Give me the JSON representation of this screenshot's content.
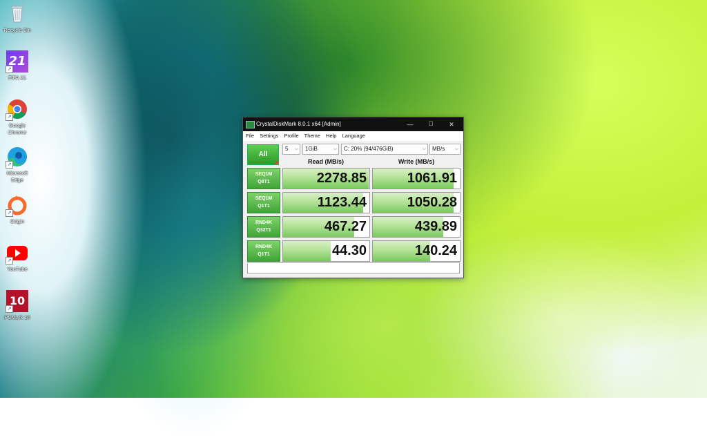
{
  "desktop": {
    "icons": [
      {
        "name": "recycle-bin",
        "label": "Recycle Bin"
      },
      {
        "name": "fifa21",
        "label": "FIFA 21",
        "glyph": "21"
      },
      {
        "name": "google-chrome",
        "label": "Google Chrome"
      },
      {
        "name": "microsoft-edge",
        "label": "Microsoft Edge"
      },
      {
        "name": "origin",
        "label": "Origin"
      },
      {
        "name": "youtube",
        "label": "YouTube"
      },
      {
        "name": "pcmark10",
        "label": "PCMark 10",
        "glyph": "10"
      }
    ]
  },
  "window": {
    "title": "CrystalDiskMark 8.0.1 x64 [Admin]",
    "controls": {
      "minimize": "—",
      "maximize": "☐",
      "close": "✕"
    },
    "menu": [
      "File",
      "Settings",
      "Profile",
      "Theme",
      "Help",
      "Language"
    ],
    "all_button": "All",
    "count": "5",
    "size": "1GiB",
    "drive": "C: 20% (94/476GiB)",
    "unit": "MB/s",
    "headers": {
      "read": "Read (MB/s)",
      "write": "Write (MB/s)"
    },
    "rows": [
      {
        "l1": "SEQ1M",
        "l2": "Q8T1",
        "read": "2278.85",
        "write": "1061.91",
        "read_level": 0.99,
        "write_level": 0.93
      },
      {
        "l1": "SEQ1M",
        "l2": "Q1T1",
        "read": "1123.44",
        "write": "1050.28",
        "read_level": 0.93,
        "write_level": 0.93
      },
      {
        "l1": "RND4K",
        "l2": "Q32T1",
        "read": "467.27",
        "write": "439.89",
        "read_level": 0.82,
        "write_level": 0.81
      },
      {
        "l1": "RND4K",
        "l2": "Q1T1",
        "read": "44.30",
        "write": "140.24",
        "read_level": 0.55,
        "write_level": 0.66
      }
    ],
    "status_text": ""
  },
  "colors": {
    "accent": "#3ea436",
    "titlebar": "#111111"
  }
}
